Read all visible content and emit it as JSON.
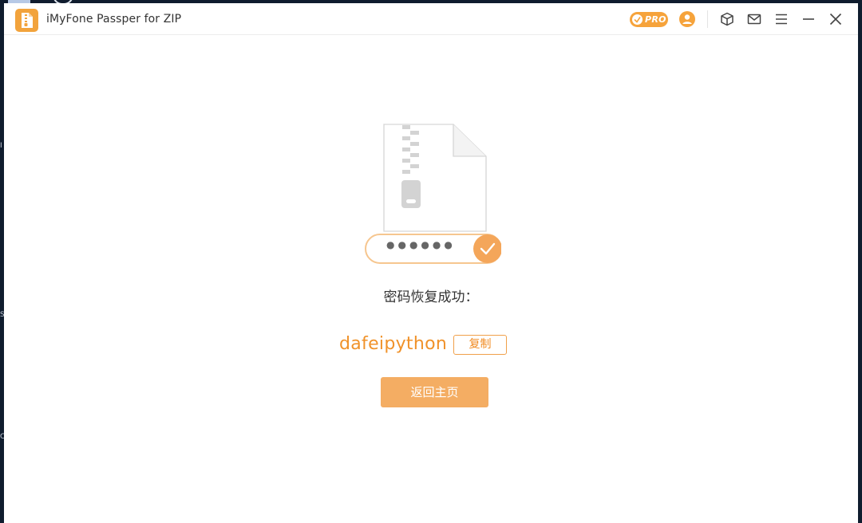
{
  "window": {
    "title": "iMyFone Passper for ZIP"
  },
  "titlebar": {
    "pro_badge_label": "PRO",
    "icons": [
      "pro-badge-icon",
      "user-icon",
      "cube-icon",
      "mail-icon",
      "menu-icon",
      "minimize-icon",
      "close-icon"
    ]
  },
  "result": {
    "masked_password": "●●●●●●",
    "success_label": "密码恢复成功：",
    "password": "dafeipython",
    "copy_label": "复制",
    "home_label": "返回主页"
  },
  "edge_glyphs": {
    "g1": "I",
    "g2": "S",
    "g3": "C"
  },
  "colors": {
    "accent": "#f6a33b",
    "password_text": "#f0922a",
    "home_button": "#f4ad63",
    "success_check": "#f4a65a",
    "background_dark": "#0f1c2e"
  }
}
